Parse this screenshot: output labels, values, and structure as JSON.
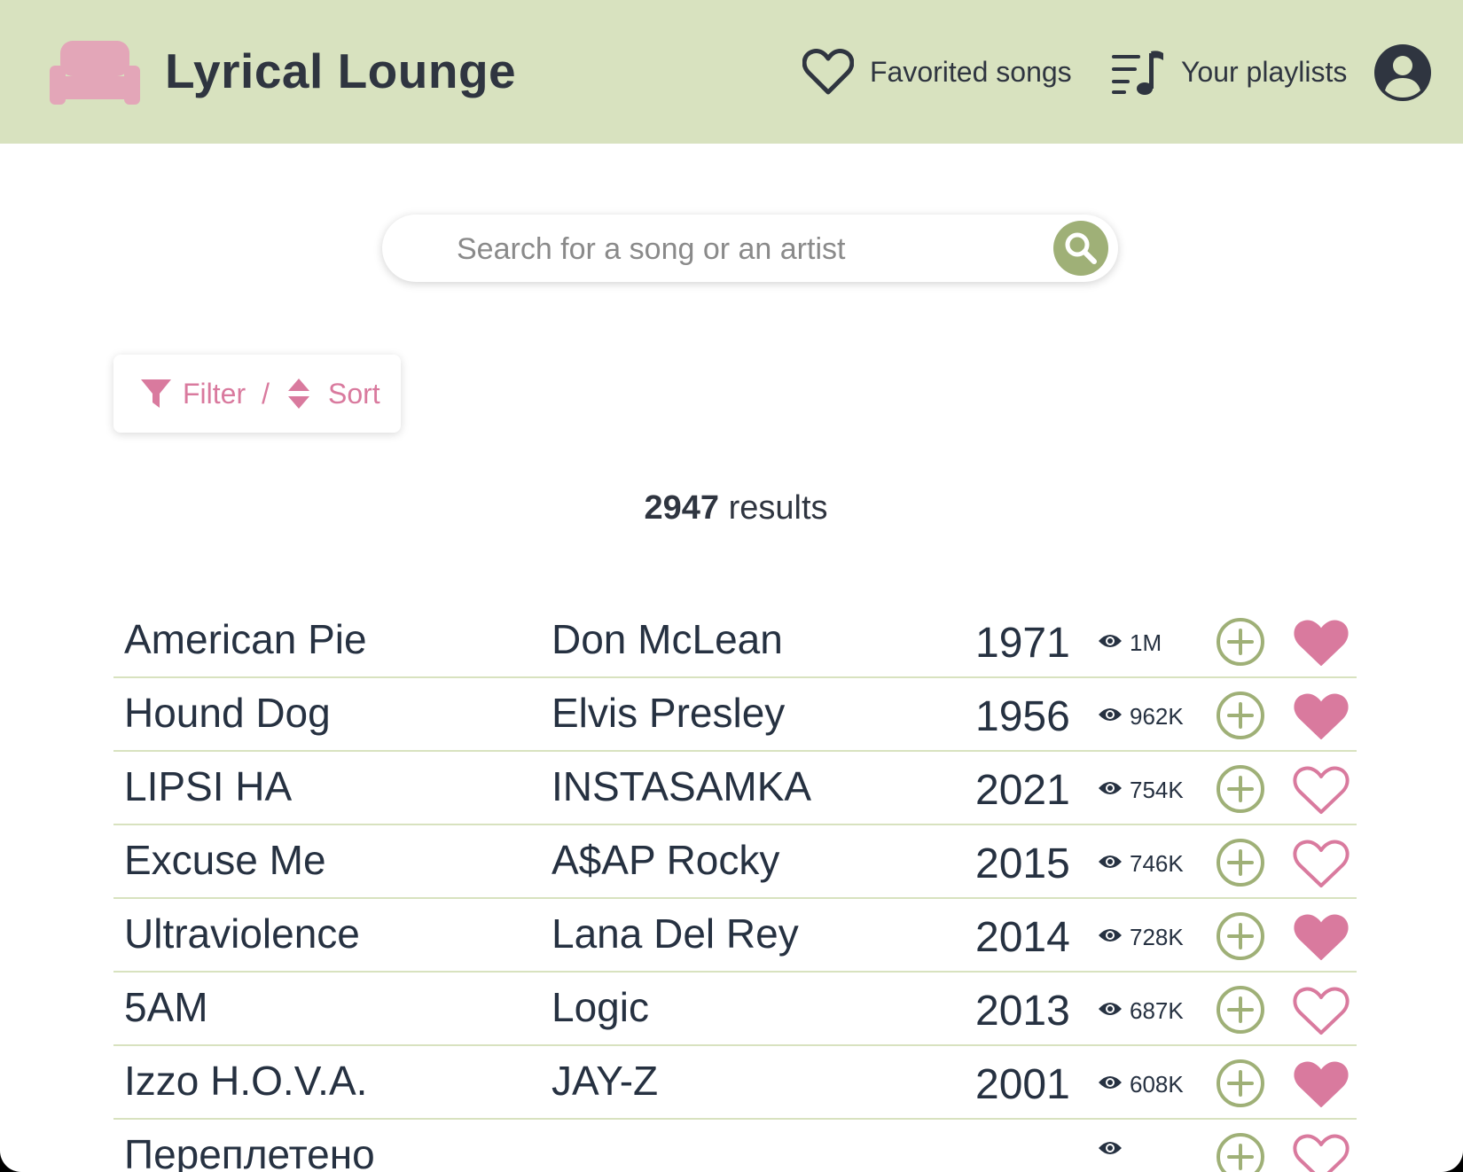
{
  "header": {
    "app_title": "Lyrical Lounge",
    "logo_icon": "couch-icon",
    "nav_favorites_label": "Favorited songs",
    "nav_playlists_label": "Your playlists",
    "avatar_icon": "user-icon"
  },
  "search": {
    "placeholder": "Search for a song or an artist",
    "button_icon": "search-icon"
  },
  "filter_sort": {
    "filter_label": "Filter",
    "separator": "/",
    "sort_label": "Sort"
  },
  "results": {
    "count": "2947",
    "suffix": "results"
  },
  "colors": {
    "header_bg": "#d8e2bf",
    "accent_green": "#9fb077",
    "accent_pink": "#d97a9e",
    "text_dark": "#263141"
  },
  "songs": [
    {
      "title": "American Pie",
      "artist": "Don McLean",
      "year": "1971",
      "views": "1M",
      "favorited": true
    },
    {
      "title": "Hound Dog",
      "artist": "Elvis Presley",
      "year": "1956",
      "views": "962K",
      "favorited": true
    },
    {
      "title": "LIPSI HA",
      "artist": "INSTASAMKA",
      "year": "2021",
      "views": "754K",
      "favorited": false
    },
    {
      "title": "Excuse Me",
      "artist": "A$AP Rocky",
      "year": "2015",
      "views": "746K",
      "favorited": false
    },
    {
      "title": "Ultraviolence",
      "artist": "Lana Del Rey",
      "year": "2014",
      "views": "728K",
      "favorited": true
    },
    {
      "title": "5AM",
      "artist": "Logic",
      "year": "2013",
      "views": "687K",
      "favorited": false
    },
    {
      "title": "Izzo H.O.V.A.",
      "artist": "JAY-Z",
      "year": "2001",
      "views": "608K",
      "favorited": true
    },
    {
      "title": "Переплетено",
      "artist": "",
      "year": "",
      "views": "",
      "favorited": false
    }
  ]
}
